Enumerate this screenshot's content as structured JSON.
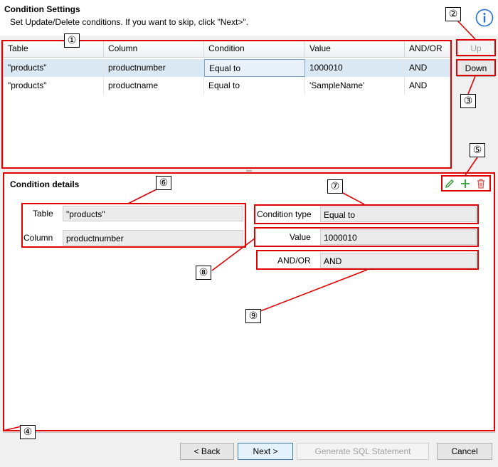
{
  "header": {
    "title": "Condition Settings",
    "subtitle": "Set Update/Delete conditions. If you want to skip, click \"Next>\"."
  },
  "grid": {
    "columns": [
      "Table",
      "Column",
      "Condition",
      "Value",
      "AND/OR"
    ],
    "rows": [
      [
        "\"products\"",
        "productnumber",
        "Equal to",
        "1000010",
        "AND"
      ],
      [
        "\"products\"",
        "productname",
        "Equal to",
        "'SampleName'",
        "AND"
      ]
    ]
  },
  "side_buttons": {
    "up": "Up",
    "down": "Down"
  },
  "details": {
    "title": "Condition details",
    "table_label": "Table",
    "table_value": "\"products\"",
    "column_label": "Column",
    "column_value": "productnumber",
    "condition_type_label": "Condition type",
    "condition_type_value": "Equal to",
    "value_label": "Value",
    "value_value": "1000010",
    "andor_label": "AND/OR",
    "andor_value": "AND"
  },
  "footer": {
    "back": "< Back",
    "next": "Next >",
    "generate": "Generate SQL Statement",
    "cancel": "Cancel"
  },
  "annotations": [
    "①",
    "②",
    "③",
    "④",
    "⑤",
    "⑥",
    "⑦",
    "⑧",
    "⑨"
  ],
  "colors": {
    "annotation": "#e00000",
    "selected_row": "#dbe9f4",
    "info_icon": "#1f6fd1",
    "edit_icon": "#2e9e2e",
    "delete_icon": "#d9534f"
  }
}
